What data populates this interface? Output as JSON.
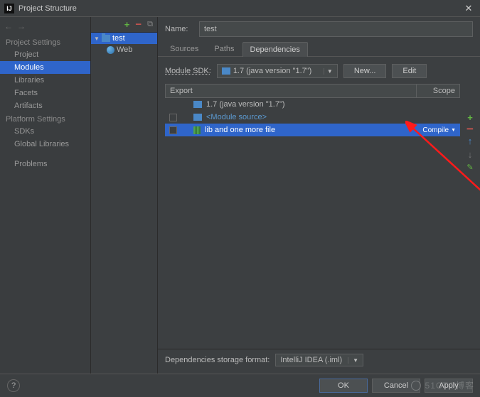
{
  "window": {
    "title": "Project Structure"
  },
  "sidebar": {
    "headers": {
      "project": "Project Settings",
      "platform": "Platform Settings"
    },
    "items": {
      "project": "Project",
      "modules": "Modules",
      "libraries": "Libraries",
      "facets": "Facets",
      "artifacts": "Artifacts",
      "sdks": "SDKs",
      "global": "Global Libraries",
      "problems": "Problems"
    }
  },
  "tree": {
    "root": "test",
    "child": "Web"
  },
  "main": {
    "name_label": "Name:",
    "name_value": "test",
    "tabs": {
      "sources": "Sources",
      "paths": "Paths",
      "deps": "Dependencies"
    },
    "sdk_label": "Module SDK:",
    "sdk_value": "1.7 (java version \"1.7\")",
    "new_btn": "New...",
    "edit_btn": "Edit",
    "table": {
      "export": "Export",
      "scope": "Scope",
      "row0": "1.7 (java version \"1.7\")",
      "row1": "<Module source>",
      "row2": "lib and one more file",
      "row2_scope": "Compile"
    },
    "storage_label": "Dependencies storage format:",
    "storage_value": "IntelliJ IDEA (.iml)"
  },
  "footer": {
    "ok": "OK",
    "cancel": "Cancel",
    "apply": "Apply"
  },
  "watermark": "51CTO博客"
}
